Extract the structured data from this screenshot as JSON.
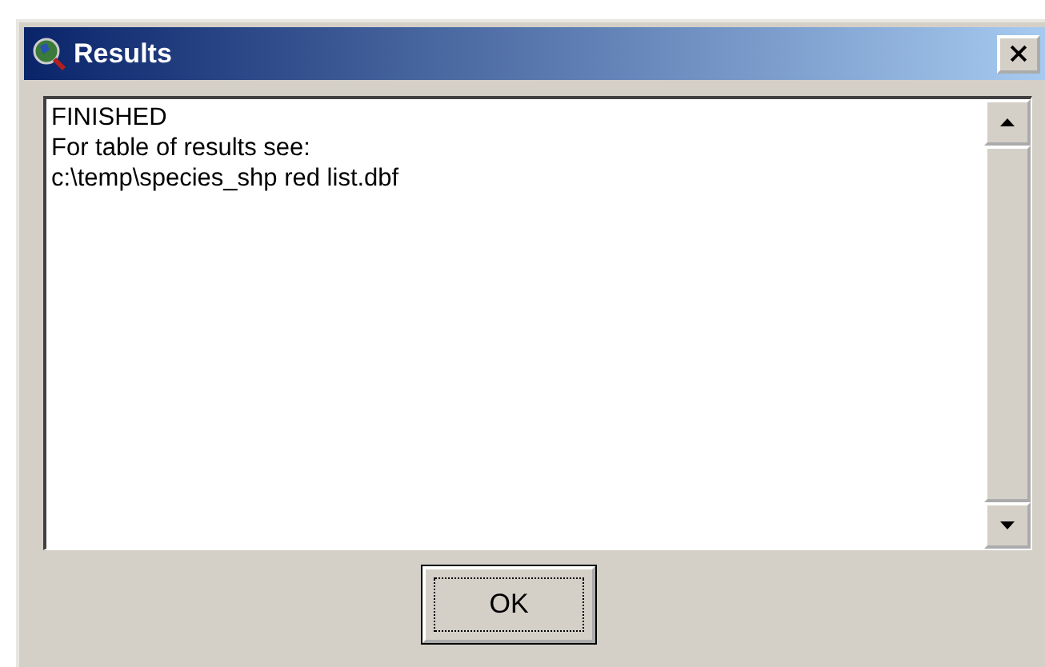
{
  "window": {
    "title": "Results"
  },
  "output_lines": [
    "FINISHED",
    "For table of results see:",
    "c:\\temp\\species_shp red list.dbf"
  ],
  "buttons": [
    {
      "label": "OK",
      "focused": true
    }
  ]
}
